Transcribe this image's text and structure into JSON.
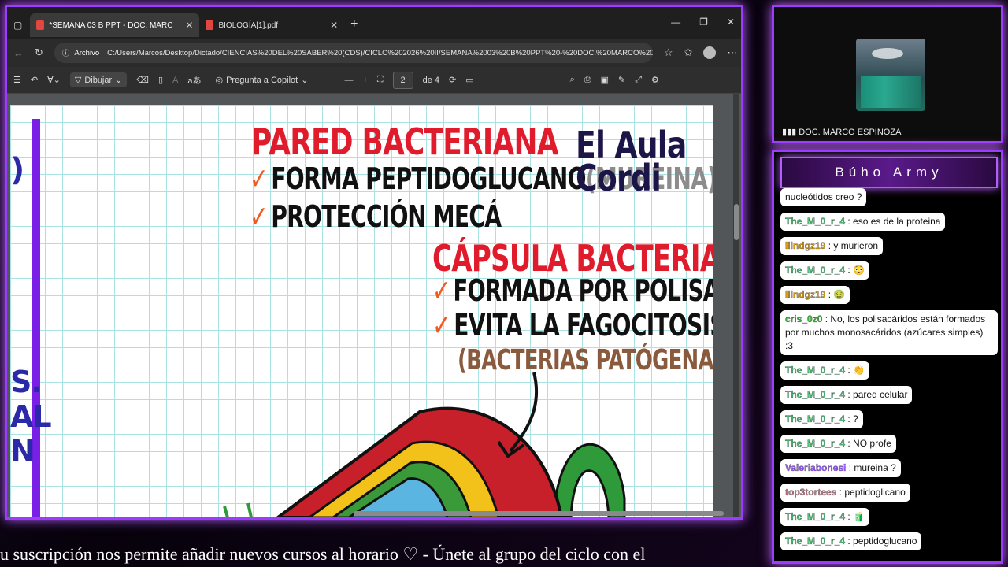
{
  "browser": {
    "tabs": [
      {
        "label": "*SEMANA 03 B PPT - DOC. MARC",
        "active": true
      },
      {
        "label": "BIOLOGÍA[1].pdf",
        "active": false
      }
    ],
    "address_prefix": "Archivo",
    "url": "C:/Users/Marcos/Desktop/Dictado/CIENCIAS%20DEL%20SABER%20(CDS)/CICLO%202026%20II/SEMANA%2003%20B%20PPT%20-%20DOC.%20MARCO%20...",
    "toolbar": {
      "draw_label": "Dibujar",
      "copilot_label": "Pregunta a Copilot",
      "page_current": "2",
      "page_total": "de 4"
    }
  },
  "slide": {
    "title1": "PARED BACTERIANA",
    "line1": "FORMA PEPTIDOGLUCANO",
    "line1_extra": "(MUREINA)",
    "line2": "PROTECCIÓN MECÁ",
    "title2": "CÁPSULA BACTERIANA",
    "line3": "FORMADA POR POLISACÁR.",
    "line4": "EVITA LA FAGOCITOSIS",
    "line5": "(BACTERIAS PATÓGENAS)",
    "logo_line1": "El Aula",
    "logo_line2": "Cordi",
    "side_text": "S.\nAL\nN",
    "check": "✓"
  },
  "cam": {
    "name": "DOC. MARCO ESPINOZA"
  },
  "chat": {
    "title": "Búho Army",
    "messages": [
      {
        "user": "",
        "text": "nucleótidos creo ?",
        "color": "#111"
      },
      {
        "user": "The_M_0_r_4",
        "text": ": eso es de la proteina",
        "color": "#4fc47a"
      },
      {
        "user": "lllndgz19",
        "text": ": y murieron",
        "color": "#d79a18"
      },
      {
        "user": "The_M_0_r_4",
        "text": ": 😳",
        "color": "#4fc47a"
      },
      {
        "user": "lllndgz19",
        "text": ": 🤢",
        "color": "#d79a18"
      },
      {
        "user": "cris_0z0",
        "text": ": No, los polisacáridos están formados por muchos monosacáridos (azúcares simples) :3",
        "color": "#33b833"
      },
      {
        "user": "The_M_0_r_4",
        "text": ": 👏",
        "color": "#4fc47a"
      },
      {
        "user": "The_M_0_r_4",
        "text": ": pared celular",
        "color": "#4fc47a"
      },
      {
        "user": "The_M_0_r_4",
        "text": ": ?",
        "color": "#4fc47a"
      },
      {
        "user": "The_M_0_r_4",
        "text": ": NO profe",
        "color": "#4fc47a"
      },
      {
        "user": "Valeriabonesi",
        "text": ": mureina ?",
        "color": "#9b5cff"
      },
      {
        "user": "top3tortees",
        "text": ": peptidoglicano",
        "color": "#c07a8a"
      },
      {
        "user": "The_M_0_r_4",
        "text": ": 🧃",
        "color": "#4fc47a"
      },
      {
        "user": "The_M_0_r_4",
        "text": ": peptidoglucano",
        "color": "#4fc47a"
      }
    ]
  },
  "ticker": "u suscripción nos permite añadir nuevos cursos al horario  ♡  -  Únete al grupo del ciclo con el"
}
